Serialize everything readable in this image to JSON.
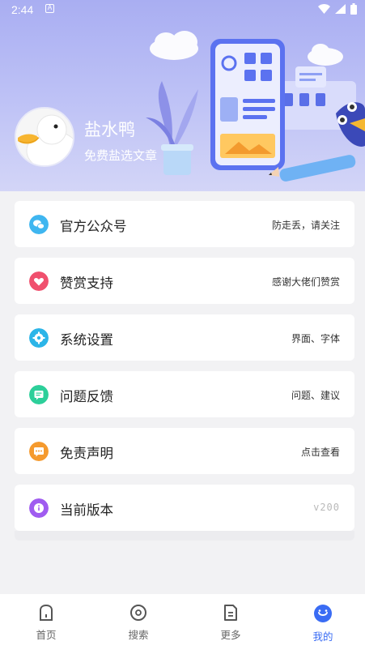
{
  "status_bar": {
    "time": "2:44",
    "notification_glyph": "A"
  },
  "profile": {
    "name": "盐水鸭",
    "subtitle": "免费盐选文章"
  },
  "menu": [
    {
      "icon": "wechat-icon",
      "color": "#3fb6f0",
      "title": "官方公众号",
      "value": "防走丢，请关注"
    },
    {
      "icon": "heart-icon",
      "color": "#f0506e",
      "title": "赞赏支持",
      "value": "感谢大佬们赞赏"
    },
    {
      "icon": "gear-icon",
      "color": "#2cb5e8",
      "title": "系统设置",
      "value": "界面、字体"
    },
    {
      "icon": "feedback-icon",
      "color": "#2dcf9a",
      "title": "问题反馈",
      "value": "问题、建议"
    },
    {
      "icon": "message-icon",
      "color": "#f59a2e",
      "title": "免责声明",
      "value": "点击查看"
    },
    {
      "icon": "info-icon",
      "color": "#a05cf0",
      "title": "当前版本",
      "value": "v200"
    }
  ],
  "nav": [
    {
      "icon": "home-icon",
      "label": "首页",
      "active": false
    },
    {
      "icon": "search-icon",
      "label": "搜索",
      "active": false
    },
    {
      "icon": "more-icon",
      "label": "更多",
      "active": false
    },
    {
      "icon": "profile-icon",
      "label": "我的",
      "active": true
    }
  ],
  "colors": {
    "accent": "#3a6cf4",
    "banner": "#a9aef2"
  }
}
